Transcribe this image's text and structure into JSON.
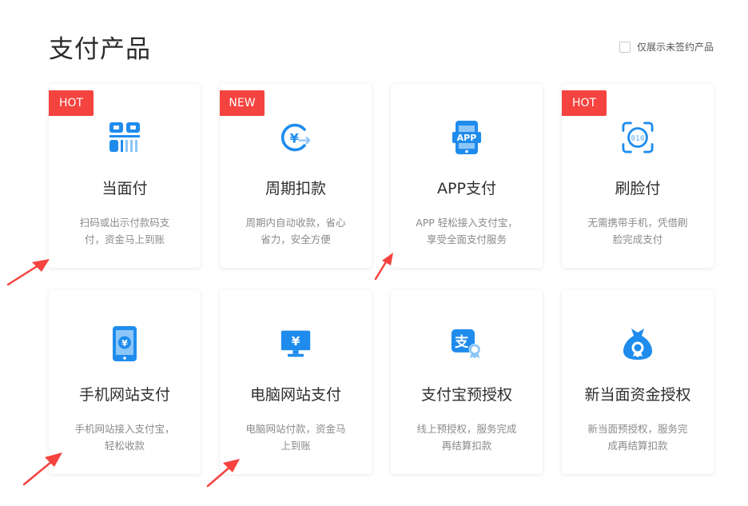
{
  "header": {
    "title": "支付产品",
    "filter_label": "仅展示未签约产品",
    "filter_checked": false
  },
  "colors": {
    "icon_blue": "#1f8ced",
    "icon_light": "#8cc6f7",
    "badge_red": "#f5433f"
  },
  "products": [
    {
      "badge": "HOT",
      "title": "当面付",
      "desc_line1": "扫码或出示付款码支",
      "desc_line2": "付，资金马上到账",
      "icon": "barcode-qr-icon"
    },
    {
      "badge": "NEW",
      "title": "周期扣款",
      "desc_line1": "周期内自动收款，省心",
      "desc_line2": "省力，安全方便",
      "icon": "yuan-cycle-icon"
    },
    {
      "badge": "",
      "title": "APP支付",
      "desc_line1": "APP 轻松接入支付宝，",
      "desc_line2": "享受全面支付服务",
      "icon": "app-phone-icon"
    },
    {
      "badge": "HOT",
      "title": "刷脸付",
      "desc_line1": "无需携带手机，凭借刷",
      "desc_line2": "脸完成支付",
      "icon": "face-scan-icon"
    },
    {
      "badge": "",
      "title": "手机网站支付",
      "desc_line1": "手机网站接入支付宝，",
      "desc_line2": "轻松收款",
      "icon": "mobile-yuan-icon"
    },
    {
      "badge": "",
      "title": "电脑网站支付",
      "desc_line1": "电脑网站付款，资金马",
      "desc_line2": "上到账",
      "icon": "monitor-yuan-icon"
    },
    {
      "badge": "",
      "title": "支付宝预授权",
      "desc_line1": "线上预授权，服务完成",
      "desc_line2": "再结算扣款",
      "icon": "alipay-badge-icon"
    },
    {
      "badge": "",
      "title": "新当面资金授权",
      "desc_line1": "新当面预授权，服务完",
      "desc_line2": "成再结算扣款",
      "icon": "money-bag-icon"
    }
  ]
}
